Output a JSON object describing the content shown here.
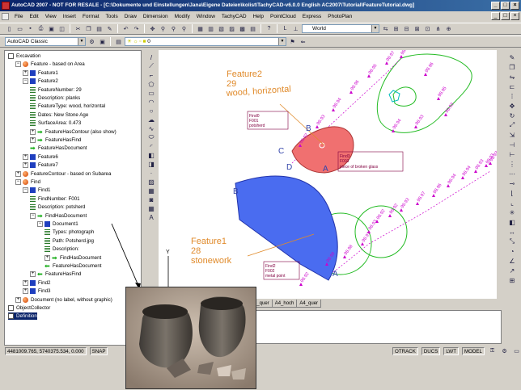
{
  "window": {
    "title": "AutoCAD 2007 - NOT FOR RESALE - [C:\\Dokumente und Einstellungen\\Jana\\Eigene Dateien\\kolist\\TachyCAD-v6.0.0 English AC2007\\Tutorial\\FeatureTutorial.dwg]"
  },
  "menu": [
    "File",
    "Edit",
    "View",
    "Insert",
    "Format",
    "Tools",
    "Draw",
    "Dimension",
    "Modify",
    "Window",
    "TachyCAD",
    "Help",
    "PointCloud",
    "Express",
    "PhotoPlan"
  ],
  "toolbar": {
    "workspace": "AutoCAD Classic",
    "layer": "0",
    "ucs": "World"
  },
  "tree": {
    "items": [
      {
        "label": "Excavation",
        "icon": "box",
        "level": 0
      },
      {
        "label": "Feature - based on Area",
        "icon": "orange",
        "level": 1,
        "exp": "−"
      },
      {
        "label": "Feature1",
        "icon": "blue",
        "level": 2,
        "exp": "+"
      },
      {
        "label": "Feature2",
        "icon": "blue",
        "level": 2,
        "exp": "−"
      },
      {
        "label": "FeatureNumber: 29",
        "icon": "lines",
        "level": 3
      },
      {
        "label": "Description: planks",
        "icon": "lines",
        "level": 3
      },
      {
        "label": "FeatureType: wood, horizontal",
        "icon": "lines",
        "level": 3
      },
      {
        "label": "Dates: New Stone Age",
        "icon": "lines",
        "level": 3
      },
      {
        "label": "SurfaceArea: 0.473",
        "icon": "lines",
        "level": 3
      },
      {
        "label": "FeatureHasContour (also show)",
        "icon": "green-right",
        "level": 3,
        "exp": "+"
      },
      {
        "label": "FeatureHasFind",
        "icon": "green-right",
        "level": 3,
        "exp": "+"
      },
      {
        "label": "FeatureHasDocument",
        "icon": "green-right",
        "level": 3
      },
      {
        "label": "Feature6",
        "icon": "blue",
        "level": 2,
        "exp": "+"
      },
      {
        "label": "Feature7",
        "icon": "blue",
        "level": 2,
        "exp": "+"
      },
      {
        "label": "FeatureContour - based on Subarea",
        "icon": "orange",
        "level": 1,
        "exp": "+"
      },
      {
        "label": "Find",
        "icon": "orange",
        "level": 1,
        "exp": "−"
      },
      {
        "label": "Find1",
        "icon": "blue",
        "level": 2,
        "exp": "−"
      },
      {
        "label": "FindNumber: F001",
        "icon": "lines",
        "level": 3
      },
      {
        "label": "Description: potsherd",
        "icon": "lines",
        "level": 3
      },
      {
        "label": "FindHasDocument",
        "icon": "green-right",
        "level": 3,
        "exp": "−"
      },
      {
        "label": "Document1",
        "icon": "blue",
        "level": 4,
        "exp": "−"
      },
      {
        "label": "Types: photograph",
        "icon": "lines",
        "level": 5
      },
      {
        "label": "Path: Potsherd.jpg",
        "icon": "lines",
        "level": 5
      },
      {
        "label": "Description:",
        "icon": "lines",
        "level": 5
      },
      {
        "label": "FindHasDocument",
        "icon": "green-right",
        "level": 5,
        "exp": "+"
      },
      {
        "label": "FeatureHasDocument",
        "icon": "green-left",
        "level": 5
      },
      {
        "label": "FeatureHasFind",
        "icon": "green-left",
        "level": 3,
        "exp": "+"
      },
      {
        "label": "Find2",
        "icon": "blue",
        "level": 2,
        "exp": "+"
      },
      {
        "label": "Find3",
        "icon": "blue",
        "level": 2,
        "exp": "+"
      },
      {
        "label": "Document (no label, without graphic)",
        "icon": "orange",
        "level": 1,
        "exp": "+"
      },
      {
        "label": "ObjectCollector",
        "icon": "box",
        "level": 0
      },
      {
        "label": "Definition",
        "icon": "box",
        "level": 0,
        "selected": true
      }
    ]
  },
  "drawing": {
    "feature1": {
      "name": "Feature1",
      "number": "28",
      "type": "stonework"
    },
    "feature2": {
      "name": "Feature2",
      "number": "29",
      "type": "wood, horizontal"
    },
    "find_labels": [
      [
        "Find0",
        "F001",
        "potsherd"
      ],
      [
        "Find3",
        "F003",
        "piece of broken glass"
      ],
      [
        "Find2",
        "F002",
        "metal point"
      ]
    ],
    "contour_letters": [
      "A",
      "B",
      "C",
      "D",
      "A",
      "B",
      "C",
      "D"
    ],
    "heights": [
      "98.92",
      "98.93",
      "98.94",
      "98.96",
      "98.95",
      "98.97",
      "98.98",
      "98.96",
      "98.95",
      "98.93",
      "98.94",
      "98.93",
      "98.92",
      "98.99",
      "98.98",
      "98.97",
      "98.93",
      "98.92",
      "98.92",
      "98.93",
      "98.97",
      "98.96",
      "98.94",
      "98.94",
      "98.93",
      "98.93",
      "98.92"
    ],
    "axis_y": "Y",
    "axis_x": "X"
  },
  "layout_tabs": [
    "A3_quer",
    "A4_hoch",
    "A4_quer"
  ],
  "status": {
    "coords": "4481009.765, 5740375.534, 0.000",
    "snap": "SNAP",
    "model": "MODEL",
    "ortho": "OTRACK",
    "dyn": "DUCS",
    "lwt": "LWT"
  },
  "colors": {
    "feature1_fill": "#4a6cf0",
    "feature2_fill": "#f07070",
    "label_orange": "#e08a2a",
    "contour_green": "#22bb22",
    "point_magenta": "#cc00cc",
    "title_bar": "#0a246a"
  }
}
